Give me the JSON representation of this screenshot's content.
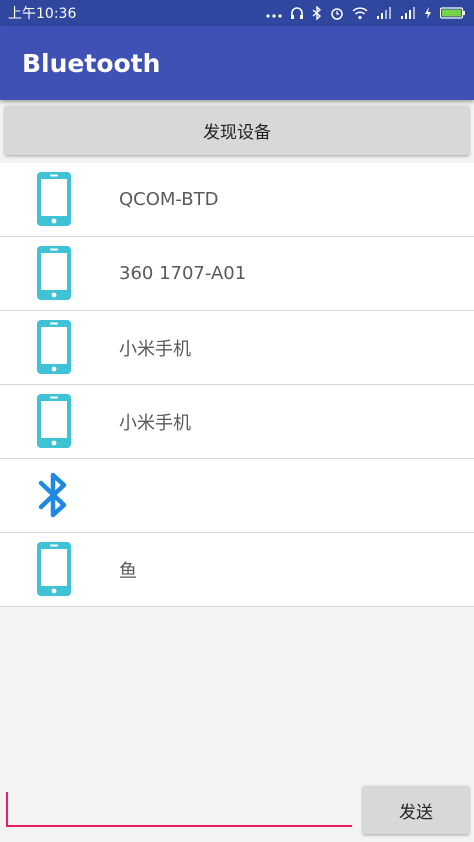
{
  "status_bar": {
    "time": "上午10:36",
    "icons": [
      "more-dots-icon",
      "headset-icon",
      "bluetooth-icon",
      "alarm-icon",
      "wifi-icon",
      "signal-icon",
      "signal-icon",
      "charging-icon",
      "battery-icon"
    ]
  },
  "app_bar": {
    "title": "Bluetooth"
  },
  "discover_button": {
    "label": "发现设备"
  },
  "devices": [
    {
      "icon": "phone-icon",
      "name": "QCOM-BTD"
    },
    {
      "icon": "phone-icon",
      "name": "360 1707-A01"
    },
    {
      "icon": "phone-icon",
      "name": "小米手机"
    },
    {
      "icon": "phone-icon",
      "name": "小米手机"
    },
    {
      "icon": "bluetooth-icon",
      "name": ""
    },
    {
      "icon": "phone-icon",
      "name": "鱼"
    }
  ],
  "message_input": {
    "value": ""
  },
  "send_button": {
    "label": "发送"
  },
  "colors": {
    "primary": "#3f51b5",
    "primary_dark": "#3047a0",
    "accent": "#e91e63",
    "phone_icon": "#3fc1d6",
    "bluetooth_icon": "#1e88e5"
  }
}
